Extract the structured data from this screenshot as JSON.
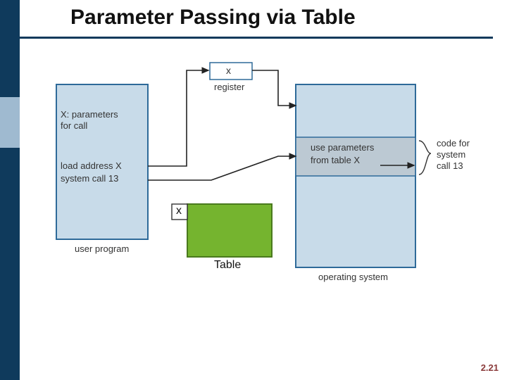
{
  "title": "Parameter Passing via Table",
  "page_number": "2.21",
  "diagram": {
    "register_value": "x",
    "register_label": "register",
    "user_box": {
      "line1": "X: parameters",
      "line2": "for call",
      "line3": "load address X",
      "line4": "system call 13",
      "caption": "user program"
    },
    "os_box": {
      "line1": "use parameters",
      "line2": "from table X",
      "caption": "operating system",
      "brace_text1": "code for",
      "brace_text2": "system",
      "brace_text3": "call 13"
    },
    "table_overlay": {
      "x_label": "x",
      "caption": "Table"
    }
  }
}
